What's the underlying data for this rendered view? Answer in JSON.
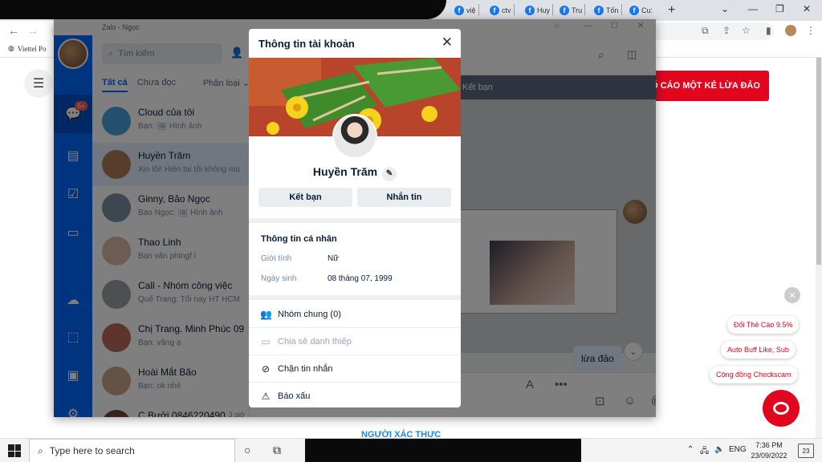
{
  "browser": {
    "tabs": [
      {
        "label": "việ"
      },
      {
        "label": "ctv"
      },
      {
        "label": "Huy"
      },
      {
        "label": "Tru"
      },
      {
        "label": "Tốn"
      },
      {
        "label": "Cu:"
      }
    ],
    "bookmark_label": "Viettel Po",
    "tab_favicon": "f"
  },
  "page": {
    "report_button": "Ố CÁO MỘT KẺ LỪA ĐẢO",
    "promos": [
      "Đổi Thẻ Cào 9.5%",
      "Auto Buff Like, Sub",
      "Cộng đồng Checkscam"
    ],
    "verify_heading": "NGƯỜI XÁC THỰC"
  },
  "zalo": {
    "window_title": "Zalo - Ngọc",
    "badge": "5+",
    "search_placeholder": "Tìm kiếm",
    "tabs": {
      "all": "Tất cả",
      "unread": "Chưa đọc",
      "filter": "Phân loại"
    },
    "conversations": [
      {
        "name": "Cloud của tôi",
        "msg": "Bạn: 🖼 Hình ảnh",
        "time": "",
        "color": "#4aa3df"
      },
      {
        "name": "Huyền Trăm",
        "msg": "Xin lỗi! Hiện tại tôi không mu",
        "time": "",
        "color": "#b07a55"
      },
      {
        "name": "Ginny, Bảo Ngọc",
        "msg": "Bao Ngọc: 🖼 Hình ảnh",
        "time": "",
        "color": "#7a8f9e"
      },
      {
        "name": "Thao Linh",
        "msg": "Bạn vân phingf í",
        "time": "",
        "color": "#d8b8a8"
      },
      {
        "name": "Call -  Nhóm công việc",
        "msg": "Quế Trang: Tối nay HT HCM",
        "time": "",
        "color": "#9aa0a6"
      },
      {
        "name": "Chị Trang. Minh Phúc 09",
        "msg": "Bạn: vâng ạ",
        "time": "",
        "color": "#b86a5a"
      },
      {
        "name": "Hoài Mắt Bão",
        "msg": "Bạn: ok nhé",
        "time": "",
        "color": "#c9a48a"
      },
      {
        "name": "C Bưởi 0846220490",
        "msg": "",
        "time": "3 giờ",
        "color": "#6b4a3a"
      }
    ],
    "chat": {
      "add_friend_bar": "Kết bạn",
      "outgoing_message": "lừa đảo"
    }
  },
  "modal": {
    "title": "Thông tin tài khoản",
    "name": "Huyền Trăm",
    "btn_add": "Kết bạn",
    "btn_message": "Nhắn tin",
    "personal_info_title": "Thông tin cá nhân",
    "gender_label": "Giới tính",
    "gender_value": "Nữ",
    "dob_label": "Ngày sinh",
    "dob_value": "08 tháng 07, 1999",
    "actions": [
      {
        "label": "Nhóm chung (0)",
        "icon": "👥",
        "muted": false
      },
      {
        "label": "Chia sẻ danh thiếp",
        "icon": "▭",
        "muted": true
      },
      {
        "label": "Chặn tin nhắn",
        "icon": "⊘",
        "muted": false
      },
      {
        "label": "Báo xấu",
        "icon": "⚠",
        "muted": false
      }
    ]
  },
  "taskbar": {
    "search_placeholder": "Type here to search",
    "lang": "ENG",
    "time": "7:36 PM",
    "date": "23/09/2022",
    "notifications": "23"
  }
}
